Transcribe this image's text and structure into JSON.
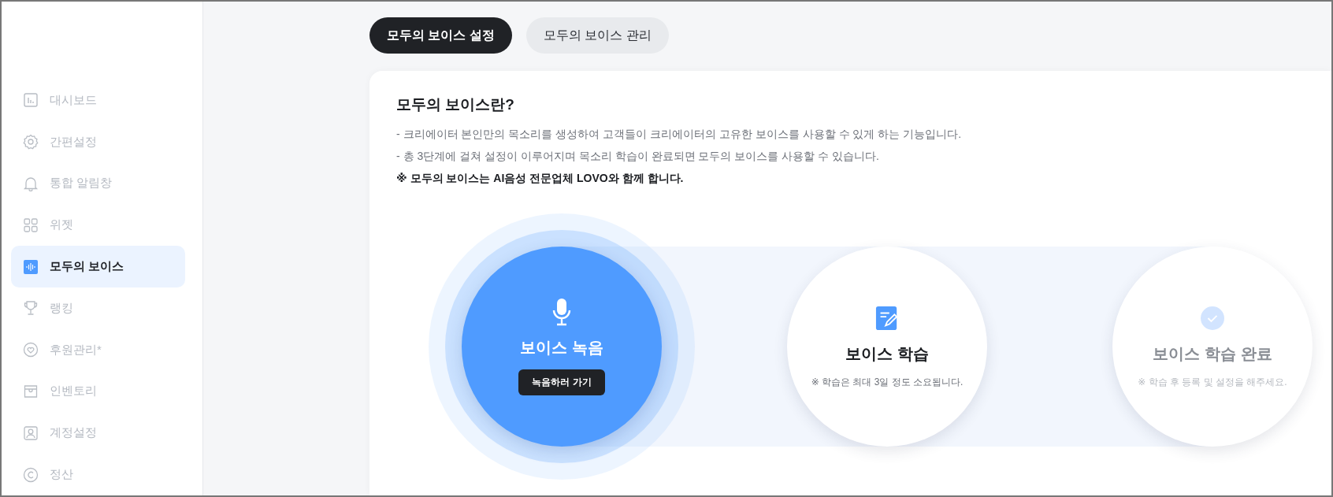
{
  "sidebar": {
    "items": [
      {
        "label": "대시보드",
        "kind": "chart",
        "selected": false
      },
      {
        "label": "간편설정",
        "kind": "gear",
        "selected": false
      },
      {
        "label": "통합 알림창",
        "kind": "bell",
        "selected": false
      },
      {
        "label": "위젯",
        "kind": "grid",
        "selected": false
      },
      {
        "label": "모두의 보이스",
        "kind": "wave",
        "selected": true
      },
      {
        "label": "랭킹",
        "kind": "trophy",
        "selected": false
      },
      {
        "label": "후원관리*",
        "kind": "heart",
        "selected": false
      },
      {
        "label": "인벤토리",
        "kind": "box",
        "selected": false
      },
      {
        "label": "계정설정",
        "kind": "person",
        "selected": false
      },
      {
        "label": "정산",
        "kind": "copyright",
        "selected": false
      }
    ]
  },
  "tabs": [
    {
      "label": "모두의 보이스 설정",
      "selected": true
    },
    {
      "label": "모두의 보이스 관리",
      "selected": false
    }
  ],
  "intro": {
    "title": "모두의 보이스란?",
    "lines": [
      "- 크리에이터 본인만의 목소리를 생성하여 고객들이 크리에이터의 고유한 보이스를 사용할 수 있게 하는 기능입니다.",
      "- 총 3단계에 걸쳐 설정이 이루어지며 목소리 학습이 완료되면 모두의 보이스를 사용할 수 있습니다."
    ],
    "notice": "※ 모두의 보이스는 AI음성 전문업체 LOVO와 함께 합니다."
  },
  "steps": [
    {
      "kind": "mic",
      "title": "보이스 녹음",
      "active": true,
      "disabled": false,
      "button": "녹음하러 가기"
    },
    {
      "kind": "note",
      "title": "보이스 학습",
      "active": false,
      "disabled": false,
      "note": "※ 학습은 최대 3일 정도 소요됩니다."
    },
    {
      "kind": "check",
      "title": "보이스 학습 완료",
      "active": false,
      "disabled": true,
      "note": "※ 학습 후 등록 및 설정을 해주세요."
    }
  ]
}
